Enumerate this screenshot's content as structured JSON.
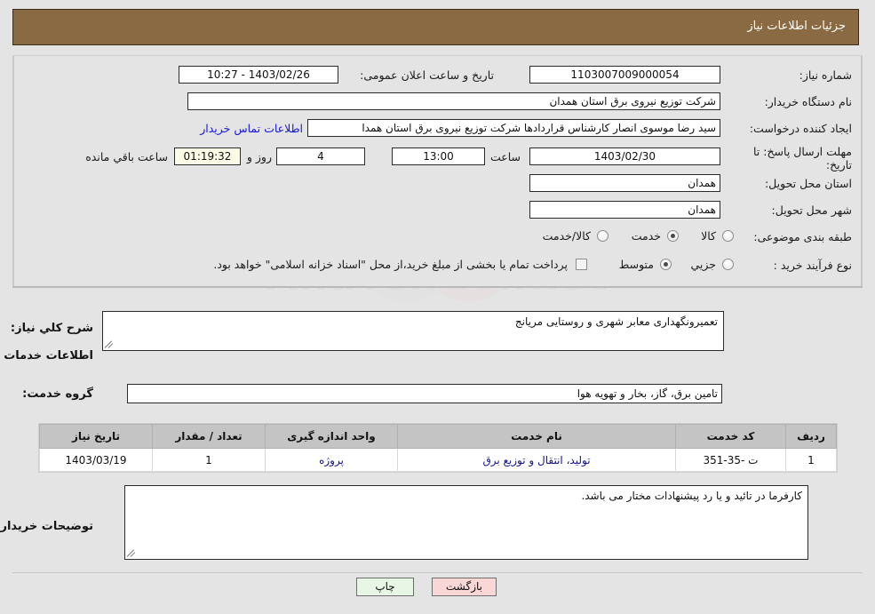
{
  "header": {
    "title": "جزئیات اطلاعات نیاز"
  },
  "watermark": {
    "text": "AnaTender.net"
  },
  "form": {
    "need_number": {
      "label": "شماره نیاز:",
      "value": "1103007009000054"
    },
    "announce_datetime": {
      "label": "تاریخ و ساعت اعلان عمومی:",
      "value": "1403/02/26 - 10:27"
    },
    "buyer_org": {
      "label": "نام دستگاه خریدار:",
      "value": "شرکت توزیع نیروی برق استان همدان"
    },
    "requester": {
      "label": "ایجاد کننده درخواست:",
      "value": "سید رضا موسوی انصار کارشناس قراردادها شرکت توزیع نیروی برق استان همدا",
      "contact_link": "اطلاعات تماس خریدار"
    },
    "deadline": {
      "label": "مهلت ارسال پاسخ: تا تاریخ:",
      "date": "1403/02/30",
      "hour_label": "ساعت",
      "hour": "13:00",
      "days": "4",
      "days_label": "روز و",
      "countdown": "01:19:32",
      "remaining_label": "ساعت باقي مانده"
    },
    "province": {
      "label": "استان محل تحویل:",
      "value": "همدان"
    },
    "city": {
      "label": "شهر محل تحویل:",
      "value": "همدان"
    },
    "category": {
      "label": "طبقه بندی موضوعی:",
      "options": [
        "کالا",
        "خدمت",
        "کالا/خدمت"
      ],
      "selected": "خدمت"
    },
    "process_type": {
      "label": "نوع فرآیند خرید :",
      "options": [
        "جزیي",
        "متوسط"
      ],
      "selected": "متوسط",
      "treasury_checkbox_label": "پرداخت تمام یا بخشی از مبلغ خرید،از محل \"اسناد خزانه اسلامی\" خواهد بود.",
      "treasury_checked": false
    }
  },
  "sections": {
    "general_desc": {
      "label": "شرح کلي نیاز:",
      "value": "تعمیرونگهداری معابر شهری و روستایی مریانج"
    },
    "services_info_title": "اطلاعات خدمات مورد نیاز",
    "service_group": {
      "label": "گروه خدمت:",
      "value": "تامین برق، گاز، بخار و تهویه هوا"
    },
    "buyer_notes": {
      "label": "توضیحات خریدار:",
      "value": "کارفرما در تائید و یا رد پیشنهادات مختار می باشد."
    }
  },
  "table": {
    "columns": [
      "ردیف",
      "کد خدمت",
      "نام خدمت",
      "واحد اندازه گیری",
      "تعداد / مقدار",
      "تاریخ نیاز"
    ],
    "rows": [
      {
        "row_no": "1",
        "service_code": "ت -35-351",
        "service_name": "تولید، انتقال و توزیع برق",
        "unit": "پروژه",
        "quantity": "1",
        "need_date": "1403/03/19"
      }
    ]
  },
  "footer": {
    "print_label": "چاپ",
    "back_label": "بازگشت"
  },
  "colors": {
    "header_bg": "#8a6a42",
    "page_bg": "#e4e4e4",
    "link": "#1616d8",
    "table_header_bg": "#c4c4c4",
    "table_cell_text": "#13138a",
    "print_btn_bg": "#e8f6e6",
    "back_btn_bg": "#f9d7d7",
    "timer_bg": "#fbfbe6"
  }
}
